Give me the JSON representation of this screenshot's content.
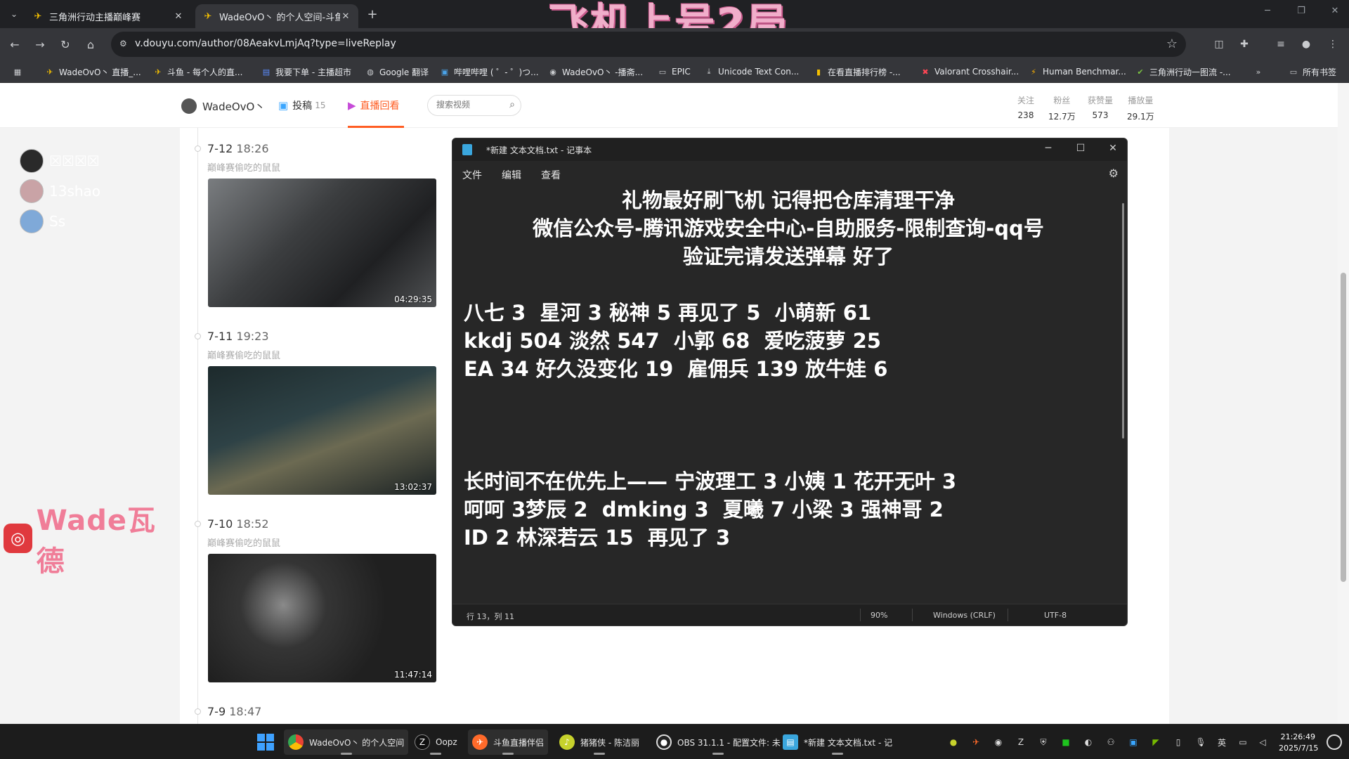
{
  "overlay_title": "飞机上号2局",
  "browser": {
    "tabs": [
      {
        "title": "三角洲行动主播巅峰赛",
        "active": false
      },
      {
        "title": "WadeOvO丶 的个人空间-斗鱼",
        "active": true
      }
    ],
    "url": "v.douyu.com/author/08AeakvLmjAq?type=liveReplay",
    "bookmarks": [
      "WadeOvO丶 直播_...",
      "斗鱼 - 每个人的直...",
      "我要下单 - 主播超市",
      "Google 翻译",
      "哔哩哔哩 ( ゜- ゜)つ...",
      "WadeOvO丶 -播斋...",
      "EPIC",
      "Unicode Text Con...",
      "在看直播排行榜 -...",
      "Valorant Crosshair...",
      "Human Benchmar...",
      "三角洲行动一图流 -..."
    ],
    "all_bookmarks": "所有书签"
  },
  "profile": {
    "username": "WadeOvO丶",
    "nav": [
      {
        "label": "投稿",
        "count": "15"
      },
      {
        "label": "直播回看",
        "count": ""
      }
    ],
    "search_placeholder": "搜索视频",
    "stats": [
      {
        "label": "关注",
        "value": "238"
      },
      {
        "label": "粉丝",
        "value": "12.7万"
      },
      {
        "label": "获赞量",
        "value": "573"
      },
      {
        "label": "播放量",
        "value": "29.1万"
      }
    ]
  },
  "side_users": [
    "☒☒☒☒",
    "13shao",
    "Ss"
  ],
  "logo_text": "Wade瓦德",
  "videos": [
    {
      "date": "7-12",
      "time": "18:26",
      "subtitle": "巅峰赛偷吃的鼠鼠",
      "duration": "04:29:35"
    },
    {
      "date": "7-11",
      "time": "19:23",
      "subtitle": "巅峰赛偷吃的鼠鼠",
      "duration": "13:02:37"
    },
    {
      "date": "7-10",
      "time": "18:52",
      "subtitle": "巅峰赛偷吃的鼠鼠",
      "duration": "11:47:14"
    },
    {
      "date": "7-9",
      "time": "18:47",
      "subtitle": "",
      "duration": ""
    }
  ],
  "notepad": {
    "title": "*新建 文本文档.txt - 记事本",
    "menu": [
      "文件",
      "编辑",
      "查看"
    ],
    "lines": [
      "礼物最好刷飞机 记得把仓库清理干净",
      "微信公众号-腾讯游戏安全中心-自助服务-限制查询-qq号",
      "验证完请发送弹幕 好了",
      "八七 3  星河 3 秘神 5 再见了 5  小萌新 61",
      "kkdj 504 淡然 547  小郭 68  爱吃菠萝 25",
      "EA 34 好久没变化 19  雇佣兵 139 放牛娃 6",
      "长时间不在优先上—— 宁波理工 3 小姨 1 花开无叶 3",
      "呵呵 3梦辰 2  dmking 3  夏曦 7 小梁 3 强神哥 2",
      "ID 2 林深若云 15  再见了 3"
    ],
    "status": {
      "position": "行 13，列 11",
      "zoom": "90%",
      "line_ending": "Windows (CRLF)",
      "encoding": "UTF-8"
    }
  },
  "taskbar": {
    "items": [
      {
        "label": "WadeOvO丶 的个人空间"
      },
      {
        "label": "Oopz"
      },
      {
        "label": "斗鱼直播伴侣"
      },
      {
        "label": "猪猪侠 - 陈洁丽"
      },
      {
        "label": "OBS 31.1.1 - 配置文件: 未"
      },
      {
        "label": "*新建 文本文档.txt - 记"
      }
    ],
    "ime": "英",
    "time": "21:26:49",
    "date": "2025/7/15"
  }
}
